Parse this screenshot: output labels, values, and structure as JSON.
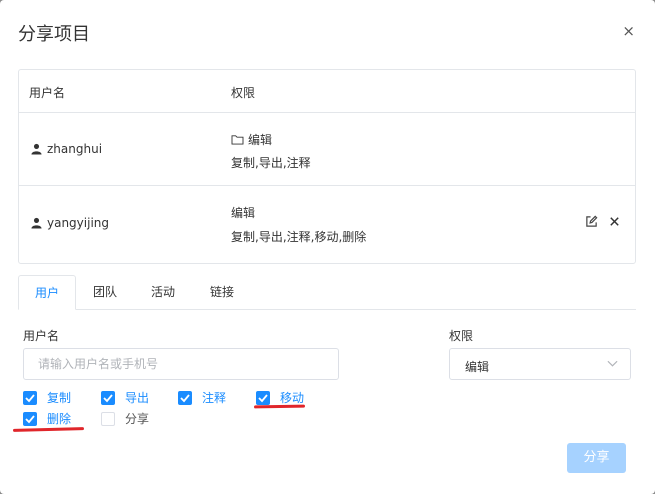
{
  "dialog": {
    "title": "分享项目",
    "close_glyph": "×"
  },
  "table": {
    "headers": {
      "user": "用户名",
      "permission": "权限"
    },
    "rows": [
      {
        "user": "zhanghui",
        "icon": "person-icon",
        "perm_icon": "folder-icon",
        "permission": "编辑",
        "abilities": "复制,导出,注释"
      },
      {
        "user": "yangyijing",
        "icon": "person-icon",
        "permission": "编辑",
        "abilities": "复制,导出,注释,移动,删除",
        "actions": [
          "edit-icon",
          "delete-icon"
        ]
      }
    ]
  },
  "tabs": [
    "用户",
    "团队",
    "活动",
    "链接"
  ],
  "active_tab": "用户",
  "form": {
    "user_label": "用户名",
    "user_placeholder": "请输入用户名或手机号",
    "permission_label": "权限",
    "permission_value": "编辑"
  },
  "checkboxes": [
    {
      "label": "复制",
      "checked": true
    },
    {
      "label": "导出",
      "checked": true
    },
    {
      "label": "注释",
      "checked": true
    },
    {
      "label": "移动",
      "checked": true
    },
    {
      "label": "删除",
      "checked": true
    },
    {
      "label": "分享",
      "checked": false
    }
  ],
  "share_button": "分享",
  "colors": {
    "accent": "#1a8cff",
    "disabled_button": "#a6d2ff",
    "annotation_red": "#e0262b"
  }
}
